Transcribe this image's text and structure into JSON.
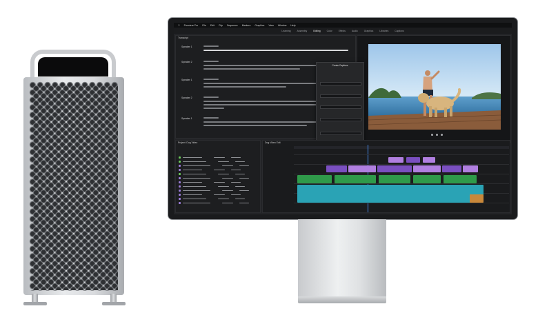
{
  "tower": {
    "name": "Mac Pro"
  },
  "display": {
    "name": "Pro Display"
  },
  "menu_bar": {
    "items": [
      "Premiere Pro",
      "File",
      "Edit",
      "Clip",
      "Sequence",
      "Markers",
      "Graphics",
      "View",
      "Window",
      "Help"
    ],
    "clock": ""
  },
  "workspace_tabs": [
    "Learning",
    "Assembly",
    "Editing",
    "Color",
    "Effects",
    "Audio",
    "Graphics",
    "Libraries",
    "Captions"
  ],
  "transcript_panel": {
    "title": "Transcript",
    "speakers": [
      "Speaker 1",
      "Speaker 2",
      "Speaker 1",
      "Speaker 2",
      "Speaker 1"
    ]
  },
  "export_dialog": {
    "title": "Create Captions"
  },
  "project_panel": {
    "title": "Project: Dog Video"
  },
  "timeline_panel": {
    "title": "Dog Video Edit"
  },
  "colors": {
    "video_clip": "#7a4fc0",
    "video_clip_alt": "#b07fe0",
    "audio_green": "#2f9a4a",
    "audio_teal": "#2aa3b5",
    "accent_blue": "#2d7bf0"
  }
}
